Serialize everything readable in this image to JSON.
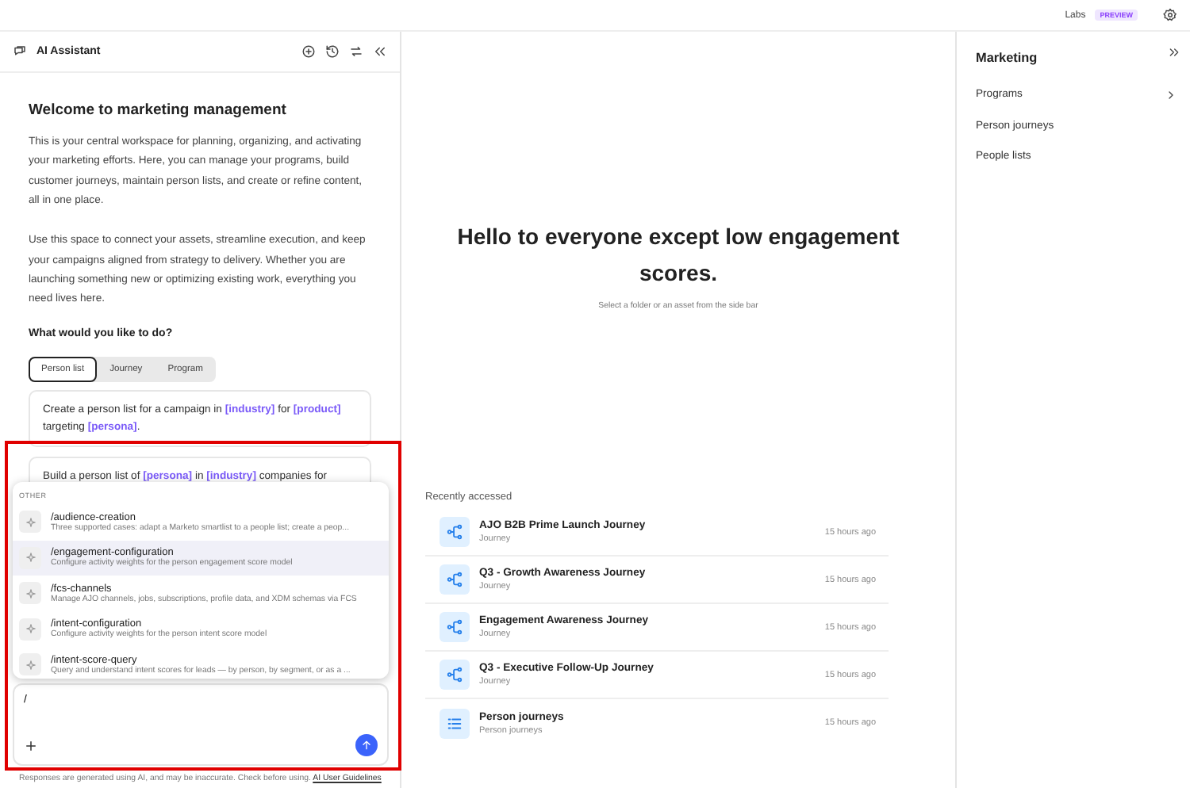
{
  "top_bar": {
    "labs": "Labs",
    "badge": "PREVIEW"
  },
  "assistant": {
    "title": "AI Assistant",
    "welcome": "Welcome to marketing management",
    "paragraphs": [
      "This is your central workspace for planning, organizing, and activating your marketing efforts. Here, you can manage your programs, build customer journeys, maintain person lists, and create or refine content, all in one place.",
      "Use this space to connect your assets, streamline execution, and keep your campaigns aligned from strategy to delivery. Whether you are launching something new or optimizing existing work, everything you need lives here."
    ],
    "question": "What would you like to do?",
    "tabs": [
      {
        "label": "Person list",
        "selected": true
      },
      {
        "label": "Journey",
        "selected": false
      },
      {
        "label": "Program",
        "selected": false
      }
    ],
    "prompts": [
      [
        {
          "kind": "plain",
          "text": "Create a person list for a campaign in "
        },
        {
          "kind": "slot",
          "text": "[industry]"
        },
        {
          "kind": "plain",
          "text": " for "
        },
        {
          "kind": "slot",
          "text": "[product]"
        },
        {
          "kind": "plain",
          "text": " targeting "
        },
        {
          "kind": "slot",
          "text": "[persona]"
        },
        {
          "kind": "plain",
          "text": "."
        }
      ],
      [
        {
          "kind": "plain",
          "text": "Build a person list of "
        },
        {
          "kind": "slot",
          "text": "[persona]"
        },
        {
          "kind": "plain",
          "text": " in "
        },
        {
          "kind": "slot",
          "text": "[industry]"
        },
        {
          "kind": "plain",
          "text": " companies for"
        }
      ]
    ],
    "menu": {
      "section": "OTHER",
      "items": [
        {
          "command": "/audience-creation",
          "description": "Three supported cases: adapt a Marketo smartlist to a people list; create a peop...",
          "selected": false
        },
        {
          "command": "/engagement-configuration",
          "description": "Configure activity weights for the person engagement score model",
          "selected": true
        },
        {
          "command": "/fcs-channels",
          "description": "Manage AJO channels, jobs, subscriptions, profile data, and XDM schemas via FCS",
          "selected": false
        },
        {
          "command": "/intent-configuration",
          "description": "Configure activity weights for the person intent score model",
          "selected": false
        },
        {
          "command": "/intent-score-query",
          "description": "Query and understand intent scores for leads — by person, by segment, or as a ...",
          "selected": false
        }
      ]
    },
    "input_value": "/",
    "disclaimer": "Responses are generated using AI, and may be inaccurate. Check before using.",
    "guidelines_link": "AI User Guidelines"
  },
  "main": {
    "heading": "Hello to everyone except low engagement scores.",
    "subtitle": "Select a folder or an asset from the side bar",
    "recent_title": "Recently accessed",
    "recent": [
      {
        "kind": "journey",
        "name": "AJO B2B Prime Launch Journey",
        "type": "Journey",
        "time": "15 hours ago"
      },
      {
        "kind": "journey",
        "name": "Q3 - Growth Awareness Journey",
        "type": "Journey",
        "time": "15 hours ago"
      },
      {
        "kind": "journey",
        "name": "Engagement Awareness Journey",
        "type": "Journey",
        "time": "15 hours ago"
      },
      {
        "kind": "journey",
        "name": "Q3 - Executive Follow-Up Journey",
        "type": "Journey",
        "time": "15 hours ago"
      },
      {
        "kind": "list",
        "name": "Person journeys",
        "type": "Person journeys",
        "time": "15 hours ago"
      }
    ]
  },
  "sidebar": {
    "title": "Marketing",
    "items": [
      {
        "label": "Programs",
        "has_children": true
      },
      {
        "label": "Person journeys",
        "has_children": false
      },
      {
        "label": "People lists",
        "has_children": false
      }
    ]
  }
}
